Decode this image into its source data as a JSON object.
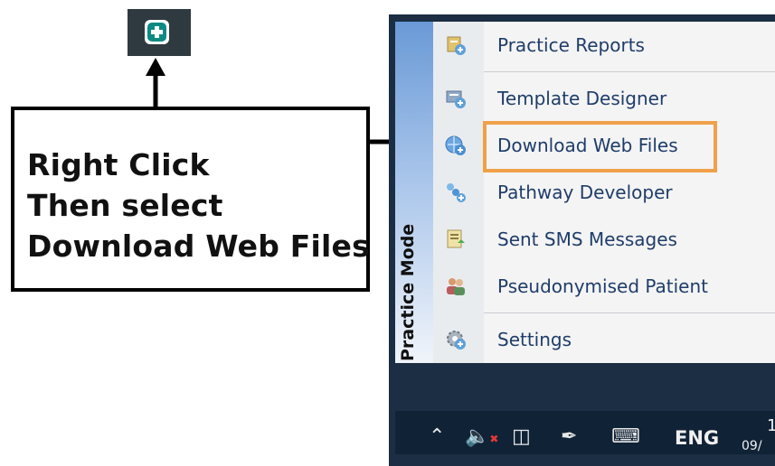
{
  "tray_icon": {
    "icon": "green-plus-app-icon"
  },
  "callout": {
    "lines": [
      "Right Click",
      "Then select",
      "Download Web Files"
    ]
  },
  "menu": {
    "side_label": "Practice Mode",
    "items": [
      {
        "label": "Practice Reports",
        "icon": "reports-icon"
      },
      {
        "label": "Template Designer",
        "icon": "template-icon"
      },
      {
        "label": "Download Web Files",
        "icon": "globe-download-icon",
        "highlighted": true
      },
      {
        "label": "Pathway Developer",
        "icon": "pathway-icon"
      },
      {
        "label": "Sent SMS Messages",
        "icon": "sms-icon"
      },
      {
        "label": "Pseudonymised Patient",
        "icon": "patients-icon"
      },
      {
        "label": "Settings",
        "icon": "settings-gear-icon"
      }
    ]
  },
  "taskbar": {
    "language": "ENG",
    "clock_partial": "1",
    "date_partial": "09/"
  },
  "colors": {
    "highlight": "#f0a04b",
    "menu_text": "#1f3d6a",
    "taskbar": "#1b2e43"
  }
}
